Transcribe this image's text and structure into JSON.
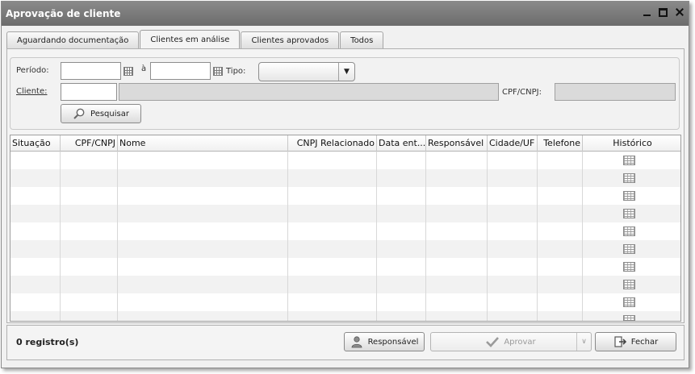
{
  "window": {
    "title": "Aprovação de cliente"
  },
  "tabs": [
    {
      "label": "Aguardando documentação",
      "active": false
    },
    {
      "label": "Clientes em análise",
      "active": true
    },
    {
      "label": "Clientes aprovados",
      "active": false
    },
    {
      "label": "Todos",
      "active": false
    }
  ],
  "filters": {
    "periodo_label": "Período:",
    "periodo_start": "",
    "periodo_sep": "à",
    "periodo_end": "",
    "tipo_label": "Tipo:",
    "tipo_value": "",
    "cliente_label": "Cliente:",
    "cliente_code": "",
    "cliente_name": "",
    "cpf_label": "CPF/CNPJ:",
    "cpf_value": "",
    "search_button": "Pesquisar"
  },
  "grid": {
    "columns": [
      "Situação",
      "CPF/CNPJ",
      "Nome",
      "CNPJ Relacionado",
      "Data ent...",
      "Responsável",
      "Cidade/UF",
      "Telefone",
      "Histórico"
    ],
    "visible_rows": 10,
    "row_icon": "calendar-grid-icon"
  },
  "footer": {
    "count_label": "0 registro(s)",
    "responsavel_button": "Responsável",
    "aprovar_button": "Aprovar",
    "fechar_button": "Fechar"
  },
  "colors": {
    "titlebar": "#7a7a7a",
    "row_alt": "#f2f2f2",
    "disabled_field": "#dadada"
  }
}
